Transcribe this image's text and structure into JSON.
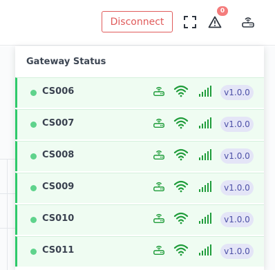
{
  "header": {
    "disconnect_label": "Disconnect",
    "alert_count": "0",
    "icons": [
      "fullscreen-icon",
      "alert-triangle-icon",
      "router-icon"
    ]
  },
  "dropdown": {
    "title": "Gateway Status",
    "gateways": [
      {
        "name": "CS006",
        "version": "v1.0.0",
        "status": "online"
      },
      {
        "name": "CS007",
        "version": "v1.0.0",
        "status": "online"
      },
      {
        "name": "CS008",
        "version": "v1.0.0",
        "status": "online"
      },
      {
        "name": "CS009",
        "version": "v1.0.0",
        "status": "online"
      },
      {
        "name": "CS010",
        "version": "v1.0.0",
        "status": "online"
      },
      {
        "name": "CS011",
        "version": "v1.0.0",
        "status": "online"
      }
    ]
  },
  "colors": {
    "accent_red": "#e05a5a",
    "online_green": "#2ec96a",
    "icon_green": "#1f9c3a",
    "version_bg": "#e4e5f7",
    "version_text": "#4b4fa6"
  }
}
